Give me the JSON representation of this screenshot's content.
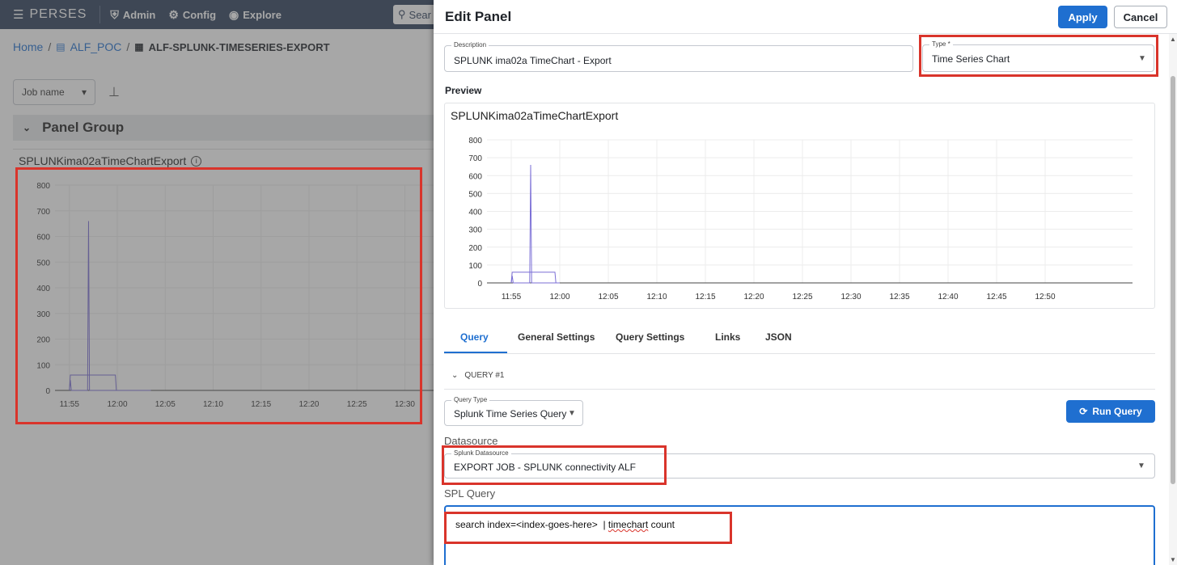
{
  "topbar": {
    "brand": "PERSES",
    "nav": [
      {
        "label": "Admin",
        "icon": "shield-icon"
      },
      {
        "label": "Config",
        "icon": "gear-icon"
      },
      {
        "label": "Explore",
        "icon": "compass-icon"
      }
    ],
    "search_label": "Sear"
  },
  "breadcrumb": {
    "home": "Home",
    "project": "ALF_POC",
    "dashboard": "ALF-SPLUNK-TIMESERIES-EXPORT"
  },
  "variables": {
    "job_name_label": "Job name"
  },
  "panel_group": {
    "title": "Panel Group"
  },
  "dashboard_panel": {
    "title": "SPLUNKima02aTimeChartExport"
  },
  "edit_panel": {
    "title": "Edit Panel",
    "apply_label": "Apply",
    "cancel_label": "Cancel",
    "description": {
      "label": "Description",
      "value": "SPLUNK ima02a TimeChart - Export"
    },
    "type": {
      "label": "Type *",
      "value": "Time Series Chart"
    },
    "preview_label": "Preview",
    "preview_title": "SPLUNKima02aTimeChartExport",
    "tabs": [
      {
        "label": "Query"
      },
      {
        "label": "General Settings"
      },
      {
        "label": "Query Settings"
      },
      {
        "label": "Links"
      },
      {
        "label": "JSON"
      }
    ],
    "query_header": "QUERY #1",
    "query_type": {
      "label": "Query Type",
      "value": "Splunk Time Series Query"
    },
    "run_query_label": "Run Query",
    "datasource_heading": "Datasource",
    "datasource": {
      "label": "Splunk Datasource",
      "value": "EXPORT JOB - SPLUNK connectivity ALF"
    },
    "spl_heading": "SPL Query",
    "spl_query_a": "search index=<index-goes-here>  | ",
    "spl_query_b": "timechart",
    "spl_query_c": " count"
  },
  "colors": {
    "accent": "#1f6fd0",
    "series": "#7b6fd6",
    "highlight": "#d9342b",
    "topbar": "#2c3f5b"
  },
  "chart_data": [
    {
      "type": "line",
      "title": "SPLUNKima02aTimeChartExport",
      "x_ticks": [
        "11:55",
        "12:00",
        "12:05",
        "12:10",
        "12:15",
        "12:20",
        "12:25",
        "12:30",
        "12:35"
      ],
      "y_ticks": [
        0,
        100,
        200,
        300,
        400,
        500,
        600,
        700,
        800
      ],
      "ylim": [
        0,
        800
      ],
      "xlim_minutes": [
        -1.5,
        38
      ],
      "series": [
        {
          "x": [
            0,
            0.1,
            0.2,
            1.9,
            2.0,
            2.1,
            8.5
          ],
          "y": [
            0,
            40,
            0,
            0,
            660,
            0,
            0
          ]
        },
        {
          "x": [
            0,
            0.1,
            0.2,
            2.0,
            2.1,
            4.8,
            4.9
          ],
          "y": [
            0,
            60,
            60,
            60,
            60,
            60,
            0
          ]
        }
      ],
      "grid": true
    },
    {
      "type": "line",
      "title": "SPLUNKima02aTimeChartExport",
      "x_ticks": [
        "11:55",
        "12:00",
        "12:05",
        "12:10",
        "12:15",
        "12:20",
        "12:25",
        "12:30",
        "12:35",
        "12:40",
        "12:45",
        "12:50"
      ],
      "y_ticks": [
        0,
        100,
        200,
        300,
        400,
        500,
        600,
        700,
        800
      ],
      "ylim": [
        0,
        800
      ],
      "xlim_minutes": [
        -2.5,
        64
      ],
      "series": [
        {
          "x": [
            0,
            0.1,
            0.2,
            1.9,
            2.0,
            2.1,
            5.0
          ],
          "y": [
            0,
            40,
            0,
            0,
            660,
            0,
            0
          ]
        },
        {
          "x": [
            0,
            0.1,
            0.2,
            2.0,
            2.1,
            4.5,
            4.6
          ],
          "y": [
            0,
            60,
            60,
            60,
            60,
            60,
            0
          ]
        }
      ],
      "grid": true
    }
  ]
}
